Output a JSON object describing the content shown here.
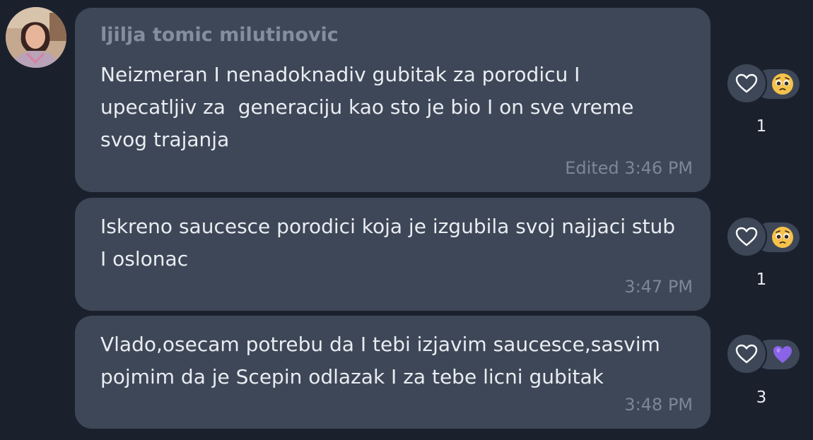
{
  "colors": {
    "background": "#1b212c",
    "bubble": "#3e4757",
    "message_text": "#e9edf2",
    "sender_name": "#858e9c",
    "timestamp": "#7d8696",
    "heart_purple": "#8a63e8",
    "emoji_yellow": "#f5c24a"
  },
  "sender": {
    "name": "ljilja tomic milutinovic"
  },
  "messages": [
    {
      "text": "Neizmeran I nenadoknadiv gubitak za porodicu I\nupecatljiv za  generaciju kao sto je bio I on sve vreme\nsvog trajanja",
      "time": "Edited 3:46 PM",
      "reaction": {
        "icon": "heart-outline-icon",
        "emoji": "pleading-face-emoji",
        "count": "1"
      }
    },
    {
      "text": "Iskreno saucesce porodici koja je izgubila svoj najjaci stub\nI oslonac",
      "time": "3:47 PM",
      "reaction": {
        "icon": "heart-outline-icon",
        "emoji": "pleading-face-emoji",
        "count": "1"
      }
    },
    {
      "text": "Vlado,osecam potrebu da I tebi izjavim saucesce,sasvim\npojmim da je Scepin odlazak I za tebe licni gubitak",
      "time": "3:48 PM",
      "reaction": {
        "icon": "heart-outline-icon",
        "emoji": "purple-heart-emoji",
        "count": "3"
      }
    }
  ]
}
